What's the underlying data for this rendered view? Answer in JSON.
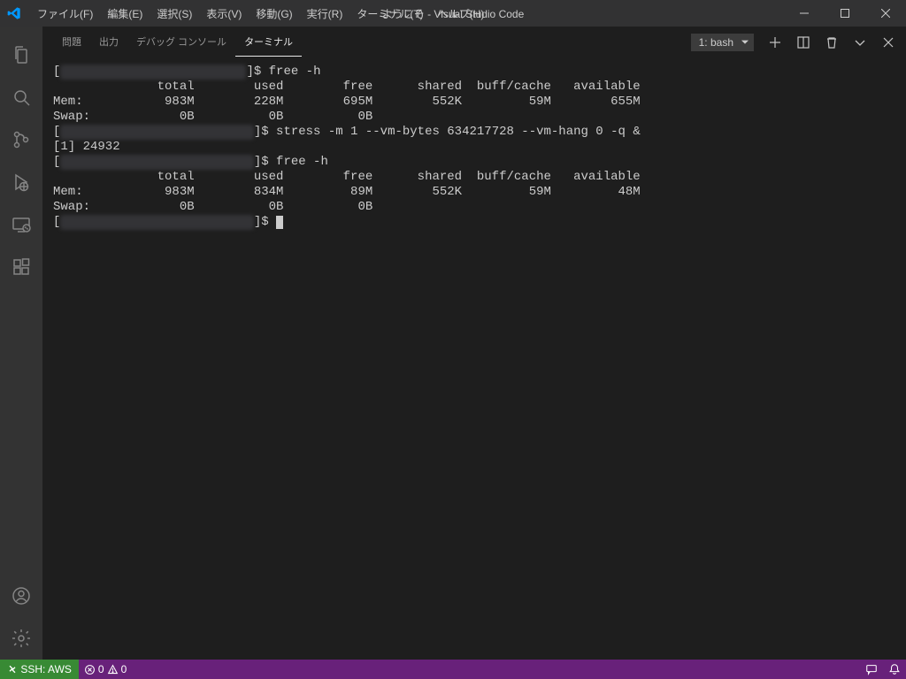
{
  "titlebar": {
    "menus": [
      "ファイル(F)",
      "編集(E)",
      "選択(S)",
      "表示(V)",
      "移動(G)",
      "実行(R)",
      "ターミナル(T)",
      "ヘルプ(H)"
    ],
    "title": "ようこそ - Visual Studio Code"
  },
  "panel": {
    "tabs": [
      "問題",
      "出力",
      "デバッグ コンソール",
      "ターミナル"
    ],
    "active": 3,
    "terminal_select": "1: bash"
  },
  "terminal": {
    "l1_pre": "[",
    "l1_blur": "                        .",
    "l1_post": "]$ free -h",
    "l2": "              total        used        free      shared  buff/cache   available",
    "l3": "Mem:           983M        228M        695M        552K         59M        655M",
    "l4": "Swap:            0B          0B          0B",
    "l5_pre": "[",
    "l5_blur": "                          ",
    "l5_post": "]$ stress -m 1 --vm-bytes 634217728 --vm-hang 0 -q &",
    "l6": "[1] 24932",
    "l7_pre": "[",
    "l7_blur": "                          ",
    "l7_post": "]$ free -h",
    "l8": "              total        used        free      shared  buff/cache   available",
    "l9": "Mem:           983M        834M         89M        552K         59M         48M",
    "l10": "Swap:            0B          0B          0B",
    "l11_pre": "[",
    "l11_blur": "                          ",
    "l11_post": "]$ "
  },
  "statusbar": {
    "remote": "SSH: AWS",
    "errors": "0",
    "warnings": "0"
  }
}
